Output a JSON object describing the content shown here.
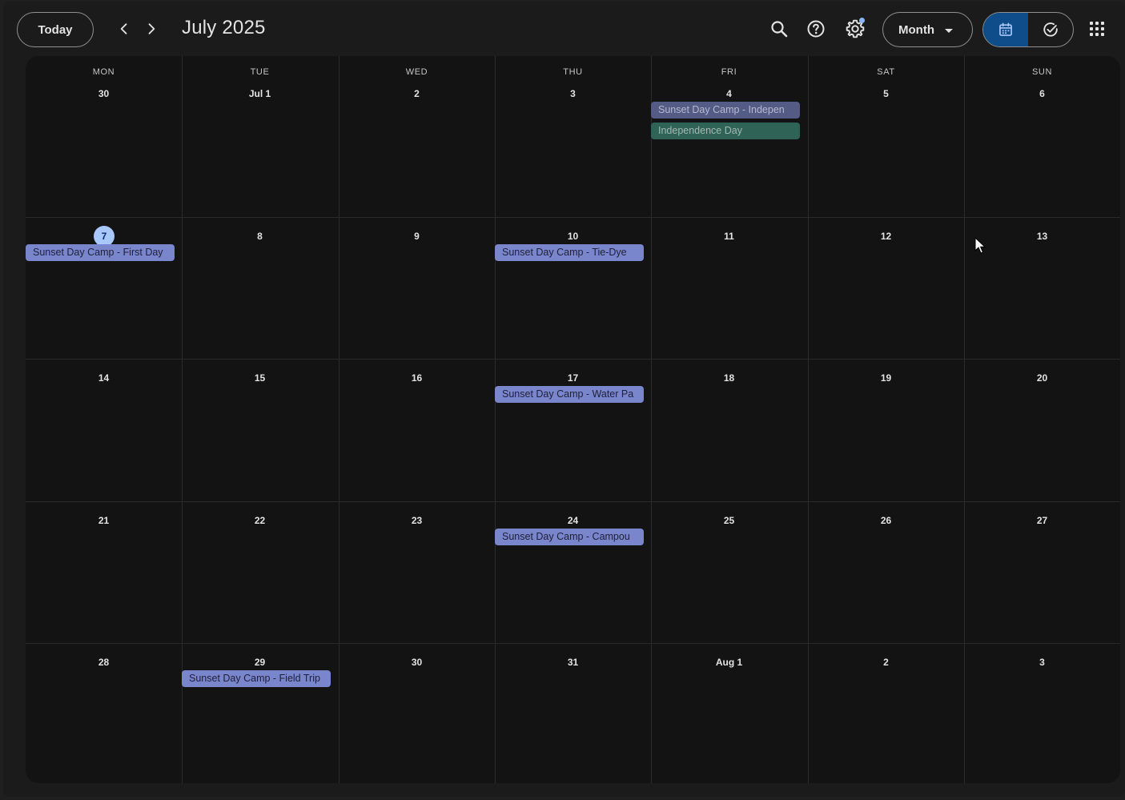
{
  "header": {
    "today_label": "Today",
    "month_title": "July 2025",
    "view_label": "Month"
  },
  "icons": {
    "prev": "chevron-left-icon",
    "next": "chevron-right-icon",
    "search": "search-icon",
    "help": "help-icon",
    "settings": "gear-icon",
    "calendar": "calendar-icon",
    "tasks": "check-circle-icon",
    "apps": "apps-grid-icon"
  },
  "colors": {
    "event": "#7986cb",
    "event_past": "#545b85",
    "holiday": "#2e6355",
    "today_highlight": "#a8c7fa",
    "active_view": "#0f4d8a"
  },
  "weekdays": [
    "MON",
    "TUE",
    "WED",
    "THU",
    "FRI",
    "SAT",
    "SUN"
  ],
  "weeks": [
    [
      "30",
      "Jul 1",
      "2",
      "3",
      "4",
      "5",
      "6"
    ],
    [
      "7",
      "8",
      "9",
      "10",
      "11",
      "12",
      "13"
    ],
    [
      "14",
      "15",
      "16",
      "17",
      "18",
      "19",
      "20"
    ],
    [
      "21",
      "22",
      "23",
      "24",
      "25",
      "26",
      "27"
    ],
    [
      "28",
      "29",
      "30",
      "31",
      "Aug 1",
      "2",
      "3"
    ]
  ],
  "today": "7",
  "events": [
    {
      "week": 0,
      "day": 4,
      "slot": 0,
      "title": "Sunset Day Camp - Indepen",
      "kind": "past"
    },
    {
      "week": 0,
      "day": 4,
      "slot": 1,
      "title": "Independence Day",
      "kind": "holiday"
    },
    {
      "week": 1,
      "day": 0,
      "slot": 0,
      "title": "Sunset Day Camp - First Day",
      "kind": "camp"
    },
    {
      "week": 1,
      "day": 3,
      "slot": 0,
      "title": "Sunset Day Camp - Tie-Dye",
      "kind": "camp"
    },
    {
      "week": 2,
      "day": 3,
      "slot": 0,
      "title": "Sunset Day Camp - Water Pa",
      "kind": "camp"
    },
    {
      "week": 3,
      "day": 3,
      "slot": 0,
      "title": "Sunset Day Camp - Campou",
      "kind": "camp"
    },
    {
      "week": 4,
      "day": 1,
      "slot": 0,
      "title": "Sunset Day Camp - Field Trip",
      "kind": "camp"
    }
  ]
}
